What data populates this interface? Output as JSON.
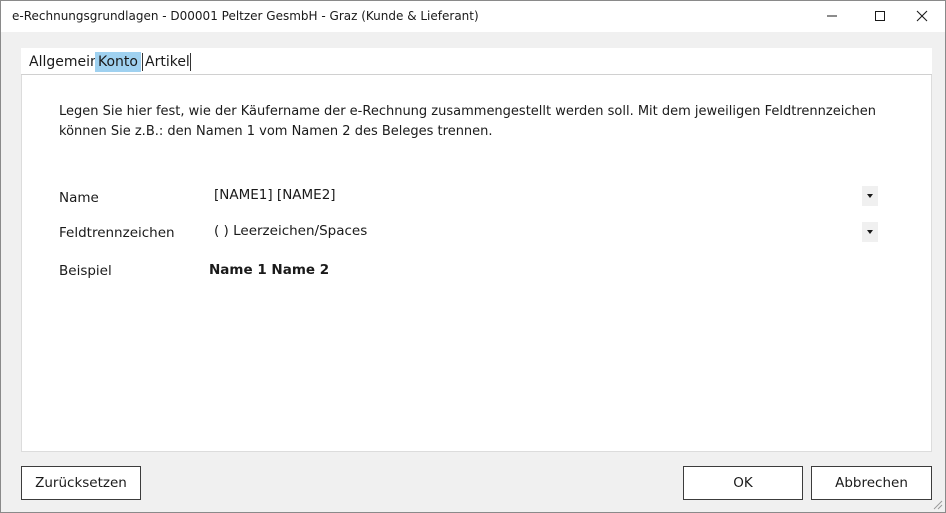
{
  "window": {
    "title": "e-Rechnungsgrundlagen - D00001 Peltzer GesmbH - Graz (Kunde & Lieferant)"
  },
  "tabs": [
    {
      "label": "Allgemein",
      "active": false
    },
    {
      "label": "Konto",
      "active": true
    },
    {
      "label": "Artikel",
      "active": false
    }
  ],
  "panel": {
    "description_line1": "Legen Sie hier fest, wie der Käufername der e-Rechnung zusammengestellt werden soll. Mit dem jeweiligen Feldtrennzeichen",
    "description_line2": "können Sie z.B.: den Namen 1 vom Namen 2 des Beleges trennen.",
    "name": {
      "label": "Name",
      "value": "[NAME1] [NAME2]"
    },
    "separator": {
      "label": "Feldtrennzeichen",
      "value": "( ) Leerzeichen/Spaces"
    },
    "example": {
      "label": "Beispiel",
      "value": "Name 1 Name 2"
    }
  },
  "buttons": {
    "reset": "Zurücksetzen",
    "ok": "OK",
    "cancel": "Abbrechen"
  },
  "colors": {
    "active_tab": "#9fd1f0",
    "background": "#f0f0f0",
    "panel": "#ffffff"
  }
}
